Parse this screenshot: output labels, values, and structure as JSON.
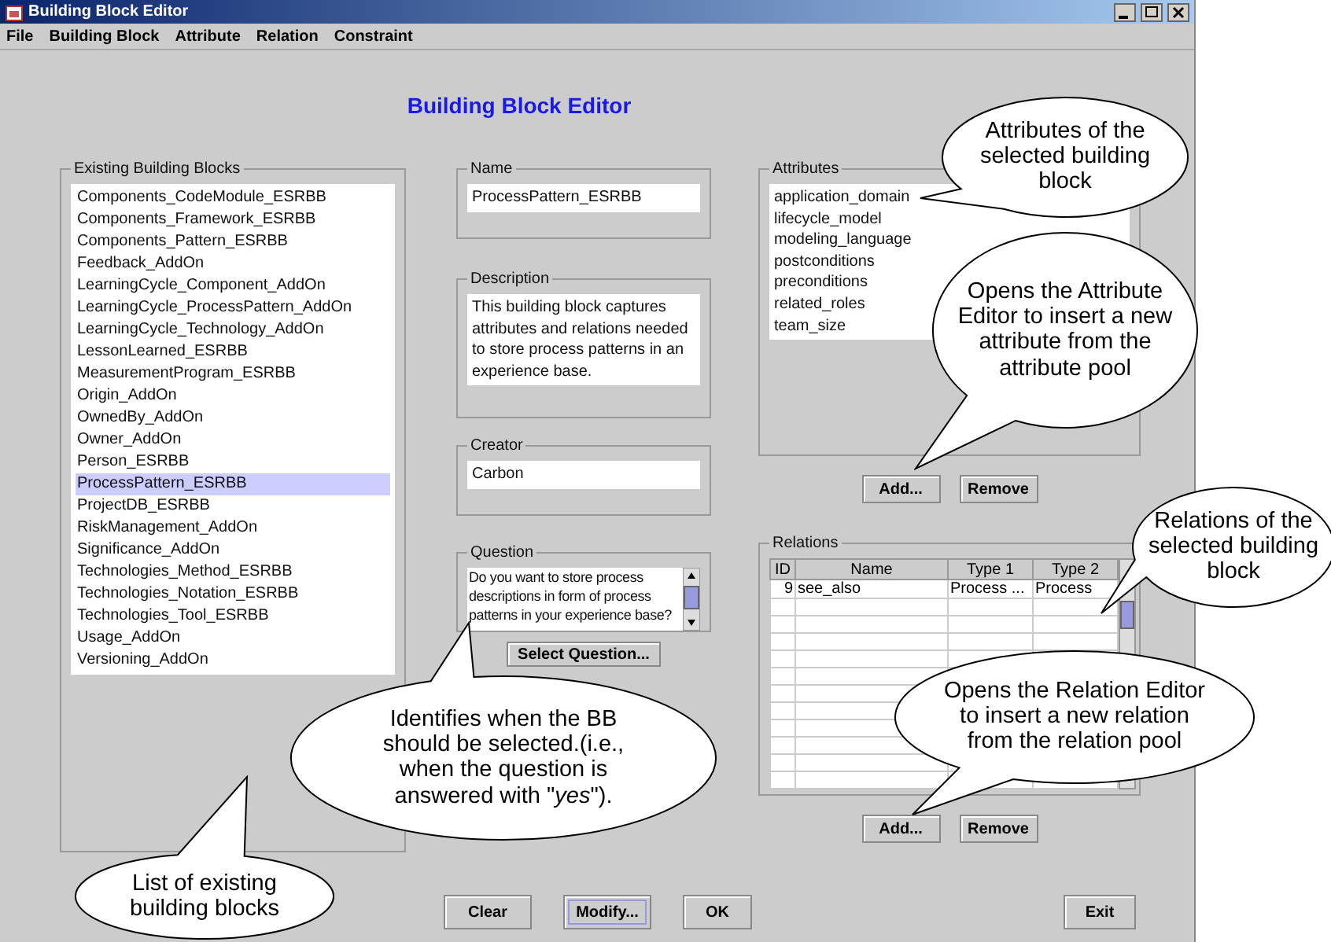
{
  "window": {
    "title": "Building Block Editor"
  },
  "menu": [
    "File",
    "Building Block",
    "Attribute",
    "Relation",
    "Constraint"
  ],
  "heading": "Building Block Editor",
  "building_blocks": {
    "label": "Existing Building Blocks",
    "items": [
      {
        "text": "Components_CodeModule_ESRBB",
        "selected": false
      },
      {
        "text": "Components_Framework_ESRBB",
        "selected": false
      },
      {
        "text": "Components_Pattern_ESRBB",
        "selected": false
      },
      {
        "text": "Feedback_AddOn",
        "selected": false
      },
      {
        "text": "LearningCycle_Component_AddOn",
        "selected": false
      },
      {
        "text": "LearningCycle_ProcessPattern_AddOn",
        "selected": false
      },
      {
        "text": "LearningCycle_Technology_AddOn",
        "selected": false
      },
      {
        "text": "LessonLearned_ESRBB",
        "selected": false
      },
      {
        "text": "MeasurementProgram_ESRBB",
        "selected": false
      },
      {
        "text": "Origin_AddOn",
        "selected": false
      },
      {
        "text": "OwnedBy_AddOn",
        "selected": false
      },
      {
        "text": "Owner_AddOn",
        "selected": false
      },
      {
        "text": "Person_ESRBB",
        "selected": false
      },
      {
        "text": "ProcessPattern_ESRBB",
        "selected": true
      },
      {
        "text": "ProjectDB_ESRBB",
        "selected": false
      },
      {
        "text": "RiskManagement_AddOn",
        "selected": false
      },
      {
        "text": "Significance_AddOn",
        "selected": false
      },
      {
        "text": "Technologies_Method_ESRBB",
        "selected": false
      },
      {
        "text": "Technologies_Notation_ESRBB",
        "selected": false
      },
      {
        "text": "Technologies_Tool_ESRBB",
        "selected": false
      },
      {
        "text": "Usage_AddOn",
        "selected": false
      },
      {
        "text": "Versioning_AddOn",
        "selected": false
      }
    ]
  },
  "name": {
    "label": "Name",
    "value": "ProcessPattern_ESRBB"
  },
  "description": {
    "label": "Description",
    "value": "This building block captures attributes and relations needed to store process patterns in an experience base."
  },
  "creator": {
    "label": "Creator",
    "value": "Carbon"
  },
  "question": {
    "label": "Question",
    "value": "Do you want to store process descriptions in form of process patterns in your experience base?",
    "button": "Select Question..."
  },
  "attributes": {
    "label": "Attributes",
    "items": [
      "application_domain",
      "lifecycle_model",
      "modeling_language",
      "postconditions",
      "preconditions",
      "related_roles",
      "team_size"
    ],
    "buttons": [
      "Add...",
      "Remove"
    ]
  },
  "relations": {
    "label": "Relations",
    "columns": [
      "ID",
      "Name",
      "Type 1",
      "Type 2"
    ],
    "rows": [
      [
        "9",
        "see_also",
        "Process ...",
        "Process"
      ]
    ],
    "buttons": [
      "Add...",
      "Remove"
    ]
  },
  "bottom_buttons": [
    {
      "label": "Clear",
      "focused": false
    },
    {
      "label": "Modify...",
      "focused": true
    },
    {
      "label": "OK",
      "focused": false
    }
  ],
  "exit_button": "Exit",
  "callouts": [
    {
      "text": "Attributes of the selected building block"
    },
    {
      "text": "Opens the Attribute Editor to insert a new attribute from the attribute pool"
    },
    {
      "text": "Relations of the selected building block"
    },
    {
      "text": "Opens the Relation Editor to insert a new relation from the relation pool"
    },
    {
      "text": "Identifies when the BB should be selected.(i.e., when the question is answered with \"*yes*\")."
    },
    {
      "text": "List of existing building blocks"
    }
  ]
}
